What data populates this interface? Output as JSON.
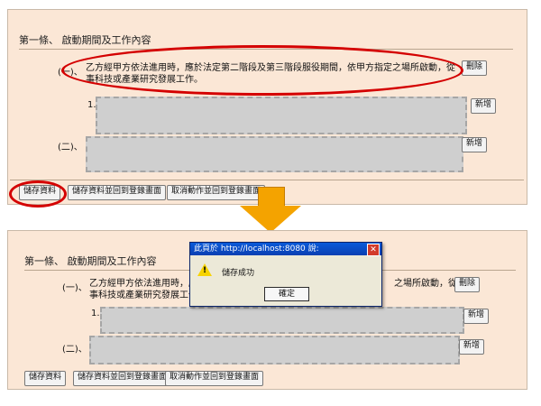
{
  "top": {
    "section_title": "第一條、 啟動期間及工作內容",
    "clause_1_number": "(一)、",
    "clause_1_text_line1": "乙方經甲方依法進用時，應於法定第二階段及第三階段服役期間，依甲方指定之場所啟動，從",
    "clause_1_text_line2": "事科技或產業研究發展工作。",
    "clause_item1_number": "1.",
    "clause_2_number": "(二)、",
    "delete_label": "刪除",
    "add_label_1": "新增",
    "add_label_2": "新增",
    "save_label": "儲存資料",
    "save_back_label": "儲存資料並回到登錄畫面",
    "cancel_back_label": "取消動作並回到登錄畫面"
  },
  "bottom": {
    "section_title": "第一條、 啟動期間及工作內容",
    "clause_1_number": "(一)、",
    "clause_1_text_line1": "乙方經甲方依法進用時，應",
    "clause_1_text_line1_tail": "之場所啟動，從",
    "clause_1_text_line2": "事科技或產業研究發展工作",
    "clause_item1_number": "1.",
    "clause_2_number": "(二)、",
    "delete_label": "刪除",
    "add_label_1": "新增",
    "add_label_2": "新增",
    "save_label": "儲存資料",
    "save_back_label": "儲存資料並回到登錄畫面",
    "cancel_back_label": "取消動作並回到登錄畫面"
  },
  "dialog": {
    "title": "此頁於 http://localhost:8080 說:",
    "message": "儲存成功",
    "ok_label": "確定",
    "close_glyph": "✕",
    "warning_glyph": "!"
  },
  "icons": {
    "warning": "warning-triangle-icon",
    "close": "close-icon",
    "arrow": "down-arrow-icon"
  },
  "colors": {
    "panel_bg": "#fbe7d6",
    "highlight_red": "#d40000",
    "arrow_orange": "#f4a300",
    "dialog_title_blue": "#0a46c4"
  }
}
